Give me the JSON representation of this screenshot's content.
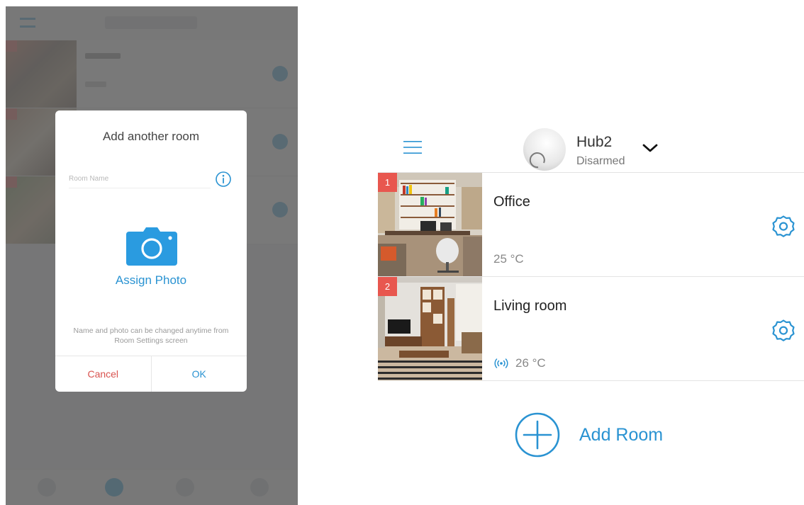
{
  "left_screen": {
    "dialog": {
      "title": "Add another room",
      "room_name_placeholder": "Room Name",
      "room_name_value": "",
      "assign_photo_label": "Assign Photo",
      "hint": "Name and photo can be changed anytime from Room Settings screen",
      "cancel_label": "Cancel",
      "ok_label": "OK"
    }
  },
  "right_screen": {
    "header": {
      "hub_name": "Hub2",
      "hub_status": "Disarmed"
    },
    "rooms": [
      {
        "index": "1",
        "name": "Office",
        "temperature": "25 °C",
        "signal_icon": false
      },
      {
        "index": "2",
        "name": "Living room",
        "temperature": "26 °C",
        "signal_icon": true
      }
    ],
    "add_room_label": "Add Room"
  },
  "colors": {
    "accent": "#2a93d2",
    "badge": "#e8574f",
    "cancel": "#d9534f",
    "overlay": "#5f5f5f"
  },
  "icons": [
    "menu-icon",
    "hub-avatar",
    "chevron-down-icon",
    "info-icon",
    "camera-icon",
    "gear-icon",
    "signal-icon",
    "plus-circle-icon"
  ]
}
